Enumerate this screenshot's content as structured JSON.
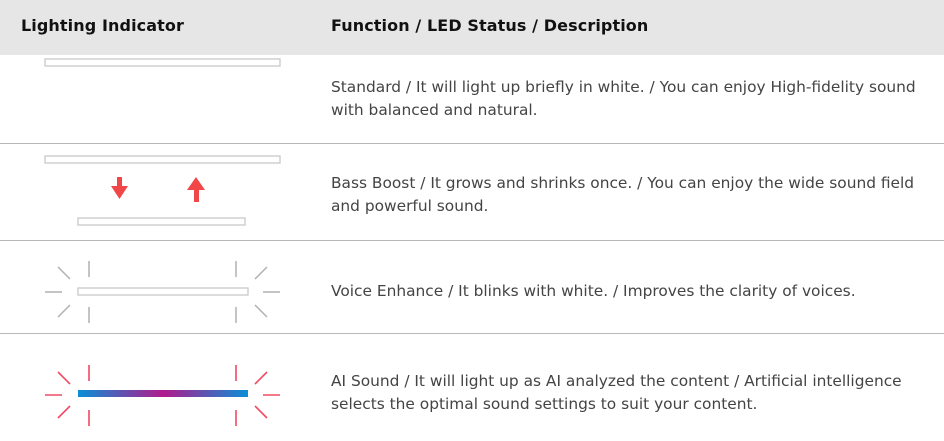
{
  "table": {
    "header": {
      "col1": "Lighting Indicator",
      "col2": "Function / LED Status / Description"
    },
    "rows": [
      {
        "illustration": "standard-light-bar",
        "description": "Standard / It will light up briefly in white. / You can enjoy High-fidelity sound with balanced and natural."
      },
      {
        "illustration": "bass-boost-grow-shrink",
        "description": "Bass Boost / It grows and shrinks once. / You can enjoy the wide sound field and powerful sound."
      },
      {
        "illustration": "voice-enhance-blink",
        "description": "Voice Enhance / It blinks with white. / Improves the clarity of voices."
      },
      {
        "illustration": "ai-sound-gradient",
        "description": "AI Sound / It will light up as AI analyzed the content / Artificial intelligence selects the optimal sound settings to suit your content."
      }
    ]
  },
  "colors": {
    "header_bg": "#e6e6e6",
    "bar_outline": "#c8c8c8",
    "arrow_red": "#f04848",
    "blink_gray": "#b0b0b0",
    "blink_red": "#f04a64",
    "gradient_blue": "#0a8fd6",
    "gradient_magenta": "#b01a8c"
  }
}
